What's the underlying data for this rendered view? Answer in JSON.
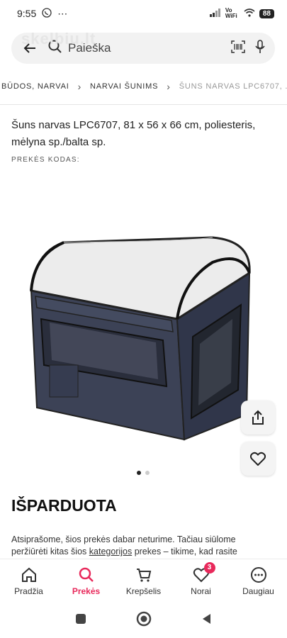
{
  "status_bar": {
    "time": "9:55",
    "network": "Vo WiFi",
    "battery": "88"
  },
  "search": {
    "placeholder": "Paieška",
    "watermark": "skelbiu.lt"
  },
  "breadcrumb": {
    "items": [
      "BŪDOS, NARVAI",
      "NARVAI ŠUNIMS",
      "ŠUNS NARVAS LPC6707, ..."
    ]
  },
  "product": {
    "title": "Šuns narvas LPC6707, 81 x 56 x 66 cm, poliesteris, mėlyna sp./balta sp.",
    "code_label": "PREKĖS KODAS:",
    "status": "IŠPARDUOTA",
    "apology_part1": "Atsiprašome, šios prekės dabar neturime. Tačiau siūlome peržiūrėti kitas šios ",
    "apology_link": "kategorijos",
    "apology_part2": " prekes – tikime, kad rasite"
  },
  "bottom_nav": {
    "items": [
      {
        "label": "Pradžia",
        "icon": "home-icon"
      },
      {
        "label": "Prekės",
        "icon": "search-icon",
        "active": true
      },
      {
        "label": "Krepšelis",
        "icon": "cart-icon"
      },
      {
        "label": "Norai",
        "icon": "heart-icon",
        "badge": "3"
      },
      {
        "label": "Daugiau",
        "icon": "more-icon"
      }
    ]
  },
  "colors": {
    "accent": "#e8295b"
  }
}
